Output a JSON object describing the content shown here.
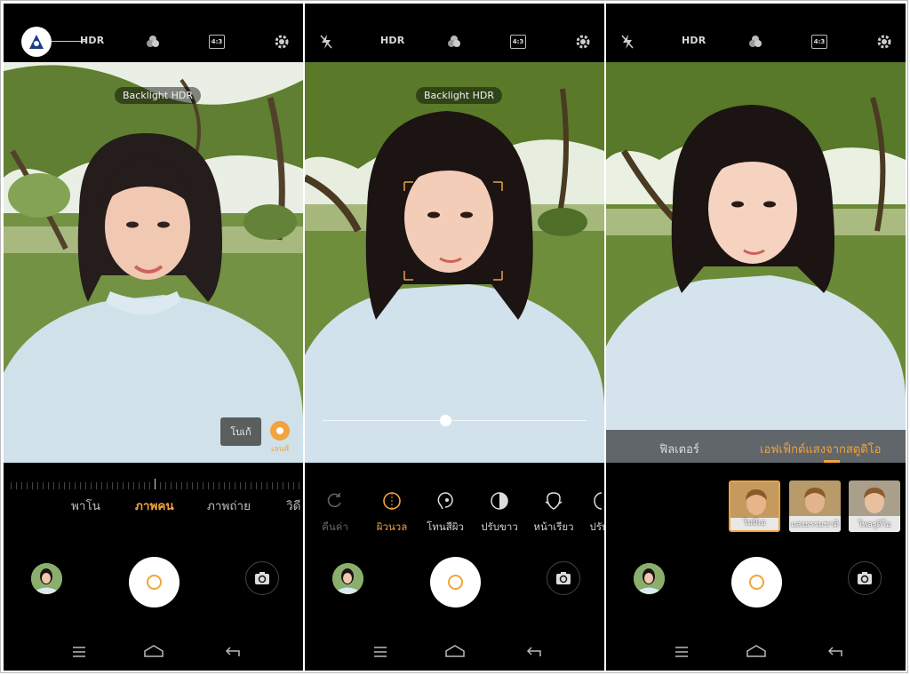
{
  "colors": {
    "accent": "#f2a33c",
    "background": "#000000",
    "icon": "#cfcfcf"
  },
  "topbar": {
    "hdr_label": "HDR",
    "ratio_label": "4:3",
    "icons": [
      "flash-off-icon",
      "hdr",
      "color-filter-icon",
      "aspect-ratio-icon",
      "gear-icon"
    ]
  },
  "preview": {
    "backlight_hdr_label": "Backlight HDR"
  },
  "panel1": {
    "portrait_button_label": "โบเก้",
    "lens_label": "เลนส์",
    "modes": [
      "พาโน",
      "ภาพคน",
      "ภาพถ่าย",
      "วิดี"
    ],
    "active_mode": "ภาพคน"
  },
  "panel2": {
    "slider_value_fraction": 0.47,
    "beauty_items": [
      {
        "label": "คืนค่า",
        "icon": "reset-icon",
        "state": "dim"
      },
      {
        "label": "ผิวนวล",
        "icon": "smooth-skin-icon",
        "state": "active"
      },
      {
        "label": "โทนสีผิว",
        "icon": "skin-tone-icon",
        "state": "normal"
      },
      {
        "label": "ปรับขาว",
        "icon": "whiten-icon",
        "state": "normal"
      },
      {
        "label": "หน้าเรียว",
        "icon": "slim-face-icon",
        "state": "normal"
      },
      {
        "label": "ปรับรู",
        "icon": "reshape-icon",
        "state": "normal"
      }
    ]
  },
  "panel3": {
    "tabs": [
      "ฟิลเตอร์",
      "เอฟเฟ็กต์แสงจากสตูดิโอ"
    ],
    "active_tab": "เอฟเฟ็กต์แสงจากสตูดิโอ",
    "filters": [
      {
        "label": "ไม่มีเอ",
        "selected": true
      },
      {
        "label": "แสงธรรมชาติ",
        "selected": false
      },
      {
        "label": "โพลรูดิโอ",
        "selected": false
      }
    ]
  }
}
